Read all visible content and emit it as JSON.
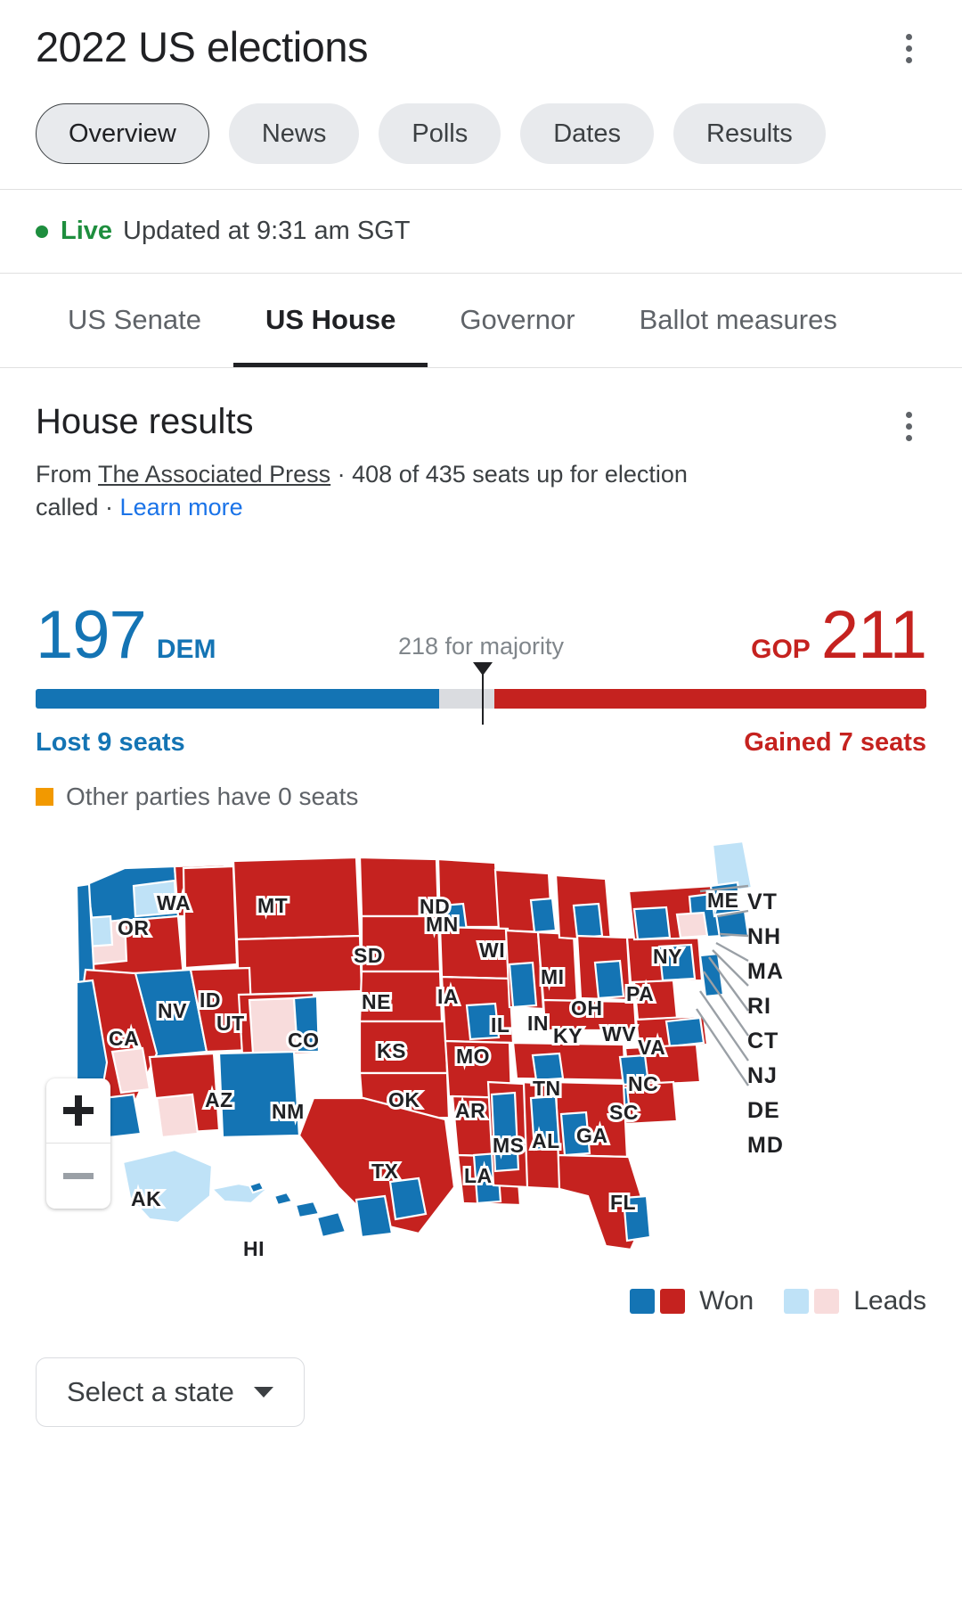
{
  "header": {
    "title": "2022 US elections",
    "menu_icon": "kebab-menu-icon"
  },
  "chips": [
    {
      "label": "Overview",
      "active": true
    },
    {
      "label": "News",
      "active": false
    },
    {
      "label": "Polls",
      "active": false
    },
    {
      "label": "Dates",
      "active": false
    },
    {
      "label": "Results",
      "active": false
    }
  ],
  "live": {
    "status": "Live",
    "updated": "Updated at 9:31 am SGT",
    "dot_color": "#1e8e3e"
  },
  "subtabs": [
    {
      "label": "US Senate",
      "active": false
    },
    {
      "label": "US House",
      "active": true
    },
    {
      "label": "Governor",
      "active": false
    },
    {
      "label": "Ballot measures",
      "active": false
    }
  ],
  "results": {
    "title": "House results",
    "menu_icon": "kebab-menu-icon",
    "attribution_prefix": "From ",
    "source": "The Associated Press",
    "attribution_mid": " · 408 of 435 seats up for election called · ",
    "learn_more": "Learn more",
    "dem": {
      "count": "197",
      "party": "DEM",
      "change": "Lost 9 seats",
      "color": "#1474b4"
    },
    "gop": {
      "count": "211",
      "party": "GOP",
      "change": "Gained 7 seats",
      "color": "#c5221f"
    },
    "majority_note": "218 for majority",
    "other_parties": "Other parties have 0 seats",
    "other_color": "#f29900",
    "total_seats": 435,
    "majority_threshold": 218
  },
  "map": {
    "zoom_in_icon": "plus-icon",
    "zoom_out_icon": "minus-icon",
    "state_labels": [
      "WA",
      "OR",
      "ID",
      "MT",
      "ND",
      "SD",
      "NE",
      "MN",
      "WI",
      "MI",
      "IA",
      "IL",
      "IN",
      "OH",
      "PA",
      "NY",
      "NV",
      "UT",
      "CO",
      "CA",
      "AZ",
      "NM",
      "KS",
      "MO",
      "KY",
      "WV",
      "VA",
      "NC",
      "TN",
      "SC",
      "OK",
      "AR",
      "MS",
      "AL",
      "GA",
      "TX",
      "LA",
      "FL",
      "AK",
      "HI"
    ],
    "callout_labels": [
      "ME",
      "VT",
      "NH",
      "MA",
      "RI",
      "CT",
      "NJ",
      "DE",
      "MD"
    ],
    "legend": [
      {
        "label": "Won",
        "colors": [
          "#1474b4",
          "#c5221f"
        ]
      },
      {
        "label": "Leads",
        "colors": [
          "#bfe2f7",
          "#f8dcdc"
        ]
      }
    ]
  },
  "select_state": {
    "label": "Select a state",
    "caret_icon": "chevron-down-icon"
  }
}
